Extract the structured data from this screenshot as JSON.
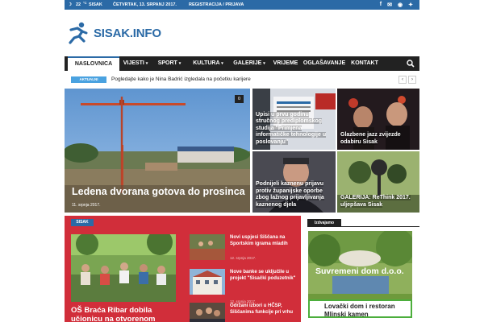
{
  "topbar": {
    "temperature": "22",
    "degree_unit": "°C",
    "city": "SISAK",
    "date": "ČETVRTAK, 13. SRPANJ 2017.",
    "auth_link": "REGISTRACIJA / PRIJAVA",
    "social_icons": [
      "facebook-icon",
      "mail-icon",
      "rss-icon",
      "twitter-icon"
    ]
  },
  "brand": {
    "name": "SISAK.INFO",
    "color": "#2b6aa6"
  },
  "nav": {
    "items": [
      {
        "label": "NASLOVNICA"
      },
      {
        "label": "VIJESTI",
        "caret": "▾"
      },
      {
        "label": "SPORT",
        "caret": "▾"
      },
      {
        "label": "KULTURA",
        "caret": "▾"
      },
      {
        "label": "GALERIJE",
        "caret": "▾"
      },
      {
        "label": "VRIJEME"
      },
      {
        "label": "OGLAŠAVANJE"
      },
      {
        "label": "KONTAKT"
      }
    ]
  },
  "ticker": {
    "badge": "AKTUALNI",
    "headline": "Pogledajte kako je Nina Badrić izgledala na početku karijere",
    "prev": "‹",
    "next": "›"
  },
  "hero": {
    "main": {
      "title": "Ledena dvorana gotova do prosinca",
      "date": "11. srpnja 2017.",
      "comments": "0"
    },
    "tiles": [
      {
        "title": "Upisi u prvu godinu stručnog prediplomskog studija \"Primjena informatičke tehnologije u poslovanju\""
      },
      {
        "title": "Glazbene jazz zvijezde odabiru Sisak"
      },
      {
        "title": "Podnijeli kaznenu prijavu protiv županijske oporbe zbog lažnog prijavljivanja kaznenog djela"
      },
      {
        "title": "GALERIJA: ReThink 2017. uljepšava Sisak"
      }
    ]
  },
  "section": {
    "badge": "SISAK",
    "accent": "#d12e3a",
    "featured_title": "OŠ Braća Ribar dobila učionicu na otvorenom",
    "side": [
      {
        "title": "Novi uspjesi Siščana na Sportskim igrama mladih",
        "date": "12. srpnja 2017."
      },
      {
        "title": "Nove banke se uključile u projekt \"Sisački poduzetnik\"",
        "date": "12. srpnja 2017."
      },
      {
        "title": "Održani izbori u HČSP, Siščanima funkcije pri vrhu"
      }
    ]
  },
  "aside": {
    "badge": "Izdvajamo",
    "ad_title": "Suvremeni dom d.o.o.",
    "ad_box_line1": "Lovački dom i restoran",
    "ad_box_line2": "Mlinski kamen"
  }
}
